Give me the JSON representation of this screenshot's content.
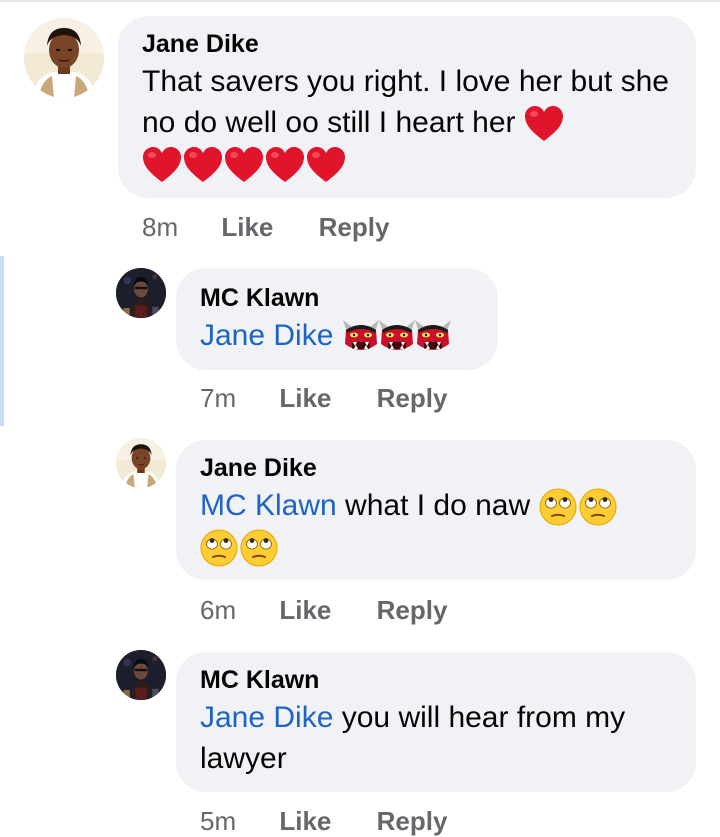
{
  "comments": [
    {
      "author": "Jane Dike",
      "text_before": "That savers you right. I love her but she no do well oo still I heart her",
      "time": "8m",
      "like": "Like",
      "reply": "Reply"
    },
    {
      "author": "MC Klawn",
      "mention": "Jane Dike",
      "text": "",
      "time": "7m",
      "like": "Like",
      "reply": "Reply"
    },
    {
      "author": "Jane Dike",
      "mention": "MC Klawn",
      "text": " what I do naw",
      "time": "6m",
      "like": "Like",
      "reply": "Reply"
    },
    {
      "author": "MC Klawn",
      "mention": "Jane Dike",
      "text": " you will hear from my lawyer",
      "time": "5m",
      "like": "Like",
      "reply": "Reply"
    }
  ],
  "icons": {
    "heart": "red-heart-emoji",
    "demon": "ogre-emoji",
    "eyeroll": "face-with-rolling-eyes-emoji"
  },
  "colors": {
    "bubble": "#f0f2f5",
    "mention": "#1e63c6",
    "meta": "#65676b",
    "reply_rail": "#c9dcf7"
  }
}
